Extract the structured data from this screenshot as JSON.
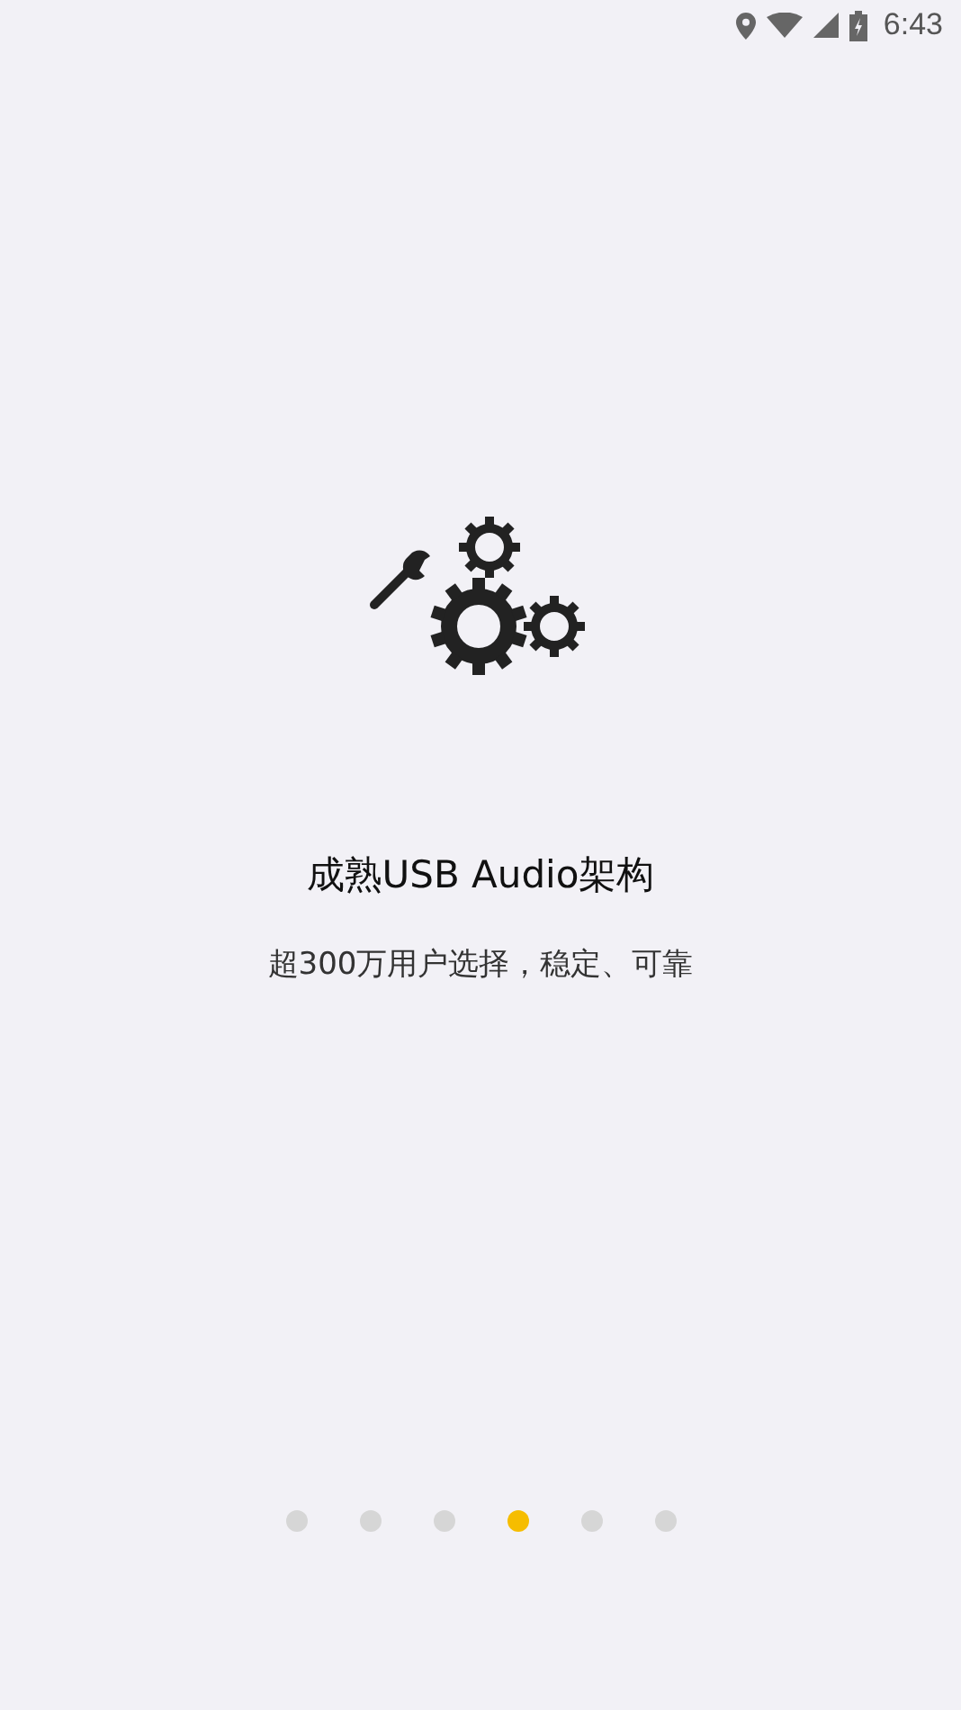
{
  "status_bar": {
    "time": "6:43"
  },
  "title": "成熟USB Audio架构",
  "subtitle": "超300万用户选择，稳定、可靠",
  "pages": [
    {
      "selected": false
    },
    {
      "selected": false
    },
    {
      "selected": false
    },
    {
      "selected": true
    },
    {
      "selected": false
    },
    {
      "selected": false
    }
  ]
}
